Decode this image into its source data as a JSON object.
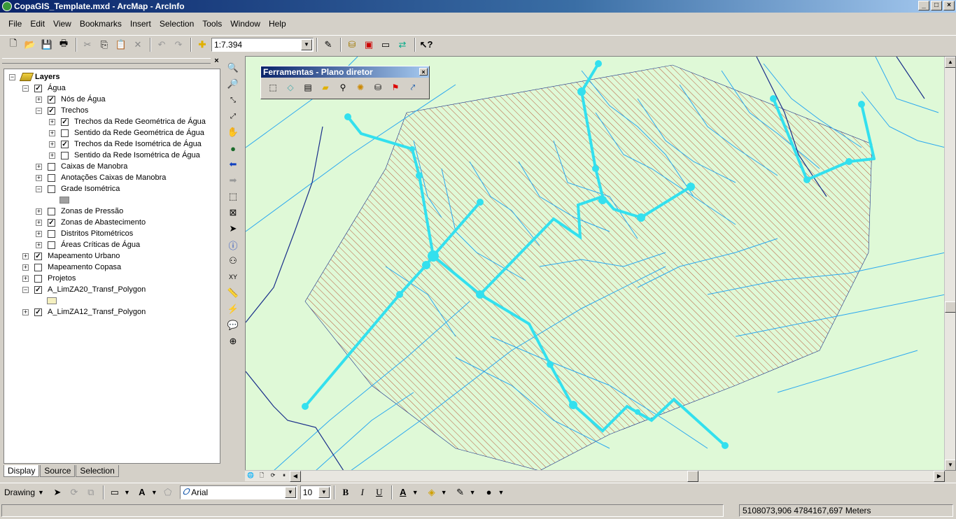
{
  "window": {
    "title": "CopaGIS_Template.mxd - ArcMap - ArcInfo"
  },
  "menu": [
    "File",
    "Edit",
    "View",
    "Bookmarks",
    "Insert",
    "Selection",
    "Tools",
    "Window",
    "Help"
  ],
  "standard_toolbar": {
    "scale": "1:7.394"
  },
  "toc": {
    "rows": [
      {
        "label": "Layers",
        "indent": 0,
        "expander": "−",
        "checkbox": null,
        "bold": true,
        "icon": "layers-icon"
      },
      {
        "label": "Água",
        "indent": 1,
        "expander": "−",
        "checkbox": true
      },
      {
        "label": "Nós de Água",
        "indent": 2,
        "expander": "+",
        "checkbox": true
      },
      {
        "label": "Trechos",
        "indent": 2,
        "expander": "−",
        "checkbox": true
      },
      {
        "label": "Trechos da Rede Geométrica de Água",
        "indent": 3,
        "expander": "+",
        "checkbox": true
      },
      {
        "label": "Sentido da Rede Geométrica de Água",
        "indent": 3,
        "expander": "+",
        "checkbox": false
      },
      {
        "label": "Trechos da Rede Isométrica de Água",
        "indent": 3,
        "expander": "+",
        "checkbox": true
      },
      {
        "label": "Sentido da Rede Isométrica de Água",
        "indent": 3,
        "expander": "+",
        "checkbox": false
      },
      {
        "label": "Caixas de Manobra",
        "indent": 2,
        "expander": "+",
        "checkbox": false
      },
      {
        "label": "Anotações Caixas de Manobra",
        "indent": 2,
        "expander": "+",
        "checkbox": false
      },
      {
        "label": "Grade Isométrica",
        "indent": 2,
        "expander": "−",
        "checkbox": false
      },
      {
        "label": "",
        "indent": 2,
        "expander": null,
        "checkbox": null,
        "swatch": "#a0a0a0"
      },
      {
        "label": "Zonas de Pressão",
        "indent": 2,
        "expander": "+",
        "checkbox": false
      },
      {
        "label": "Zonas de Abastecimento",
        "indent": 2,
        "expander": "+",
        "checkbox": true
      },
      {
        "label": "Distritos Pitométricos",
        "indent": 2,
        "expander": "+",
        "checkbox": false
      },
      {
        "label": "Áreas Críticas de Água",
        "indent": 2,
        "expander": "+",
        "checkbox": false
      },
      {
        "label": "Mapeamento Urbano",
        "indent": 1,
        "expander": "+",
        "checkbox": true
      },
      {
        "label": "Mapeamento Copasa",
        "indent": 1,
        "expander": "+",
        "checkbox": false
      },
      {
        "label": "Projetos",
        "indent": 1,
        "expander": "+",
        "checkbox": false
      },
      {
        "label": "A_LimZA20_Transf_Polygon",
        "indent": 1,
        "expander": "−",
        "checkbox": true
      },
      {
        "label": "",
        "indent": 1,
        "expander": null,
        "checkbox": null,
        "swatch": "#f5f0c0"
      },
      {
        "label": "A_LimZA12_Transf_Polygon",
        "indent": 1,
        "expander": "+",
        "checkbox": true
      }
    ],
    "tabs": [
      "Display",
      "Source",
      "Selection"
    ]
  },
  "floating_toolbar": {
    "title": "Ferramentas - Plano diretor"
  },
  "drawing_toolbar": {
    "label": "Drawing",
    "font": "Arial",
    "size": "10",
    "bold": "B",
    "italic": "I",
    "underline": "U"
  },
  "status": {
    "coordinates": "5108073,906  4784167,697 Meters"
  },
  "colors": {
    "map_bg": "#dff9d7",
    "water_line": "#2aa8f0",
    "network": "#33e0ee",
    "hatch": "#b85a3a",
    "road": "#1a2f8a"
  }
}
